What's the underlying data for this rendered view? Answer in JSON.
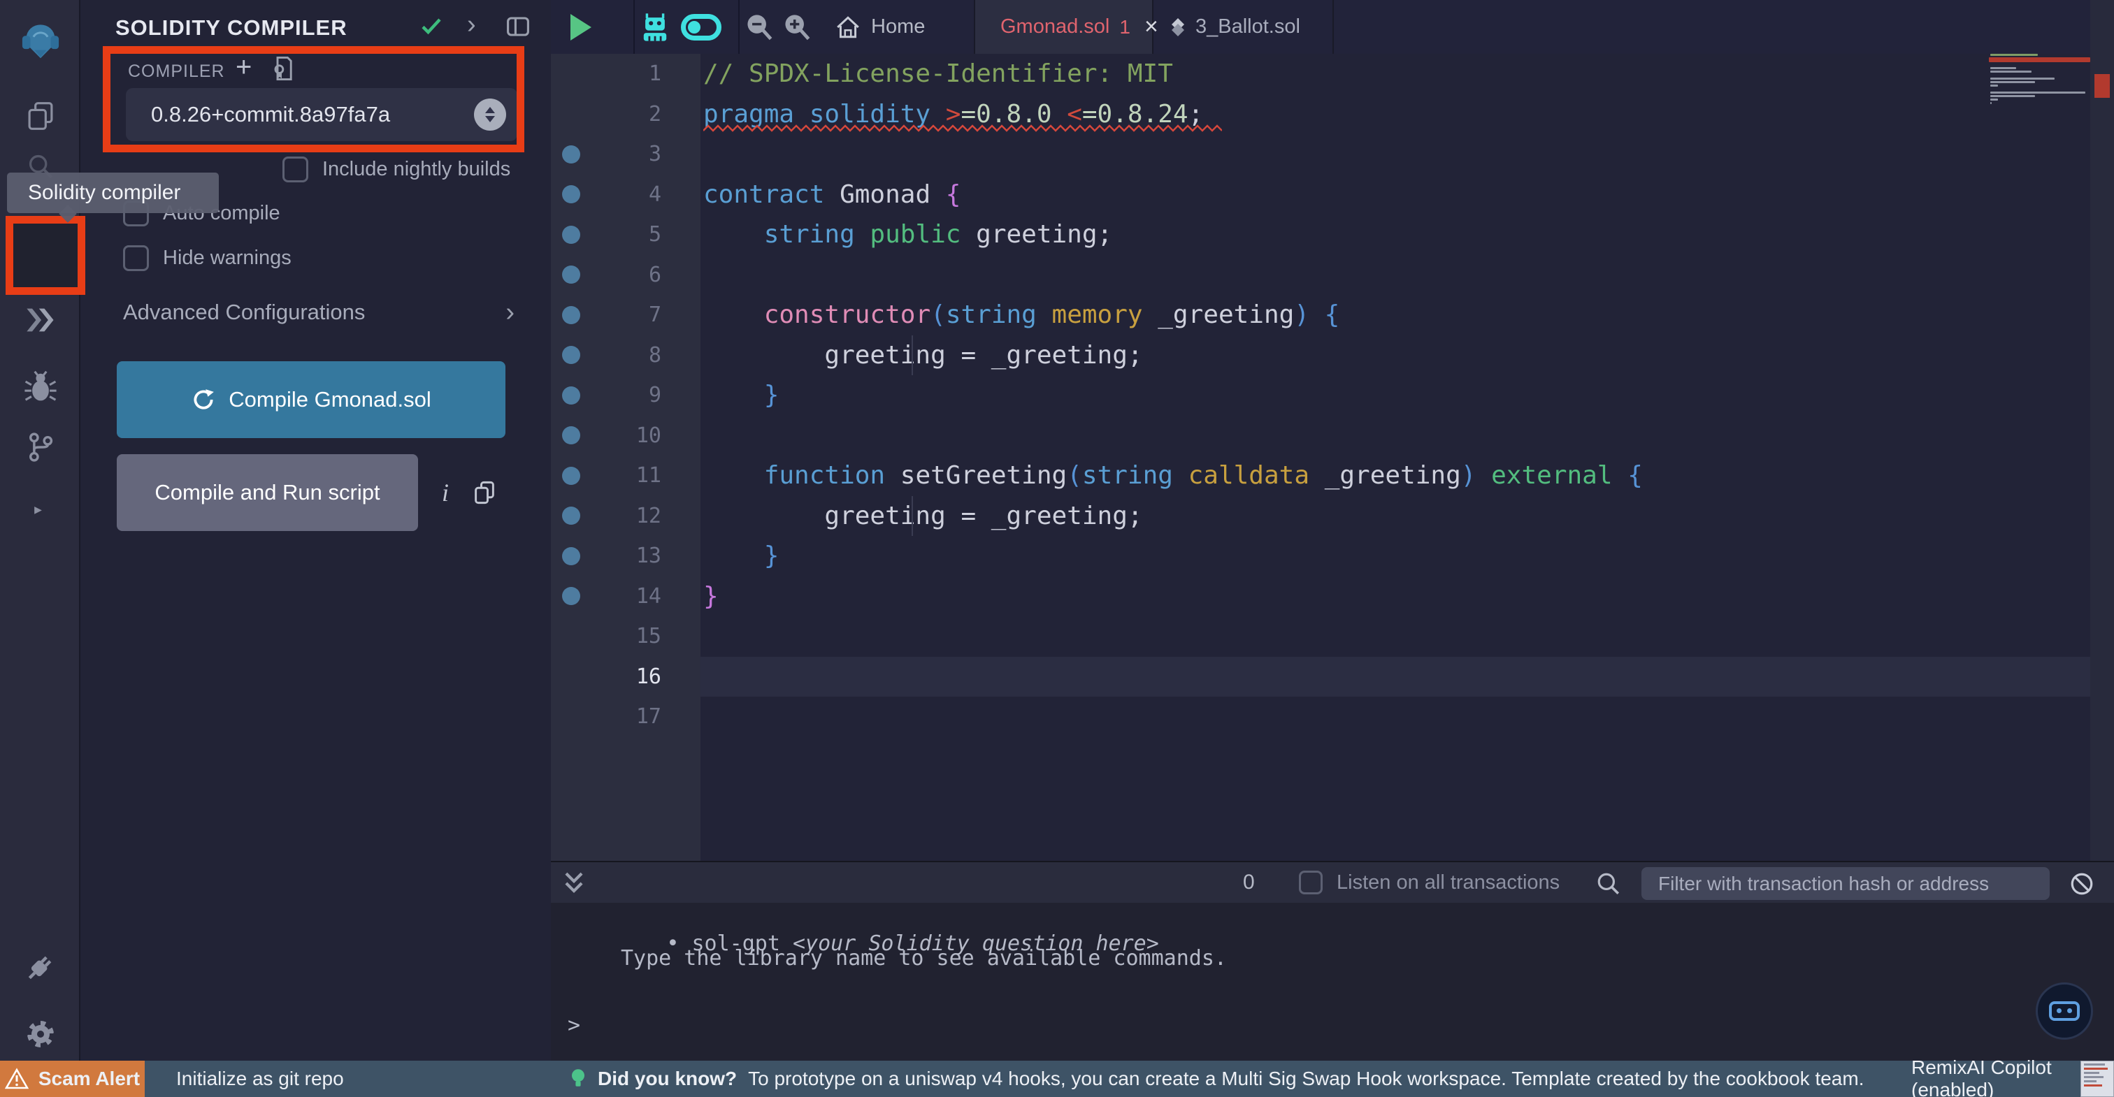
{
  "colors": {
    "accent_cyan": "#3fe0e0",
    "compile_button_blue": "#35789e",
    "run_button_gray": "#65677c",
    "annotation_red": "#e83d16",
    "scam_orange": "#d1793e",
    "statusbar_slate": "#3e5366",
    "tab_active_red": "#e0646e",
    "gutter_dot_blue": "#4e7ca0",
    "play_green": "#57c584",
    "check_green": "#3dbd7d",
    "squiggle_red": "#d6473c",
    "syntax": {
      "comment": "#83a35f",
      "keyword": "#5a9fd4",
      "operator": "#d14a3c",
      "version": "#c1d4bc",
      "plain": "#ced0dc",
      "brace1": "#c678dd",
      "brace2": "#5793d6",
      "modifier": "#53bd7f",
      "storage": "#c8a03f",
      "ctor": "#e08cb6"
    }
  },
  "sidebar": {
    "tooltip": "Solidity compiler",
    "icons": [
      "remix-logo",
      "file-explorer-icon",
      "search-icon",
      "solidity-compiler-icon",
      "deploy-run-icon",
      "debugger-icon",
      "git-icon",
      "plugin-manager-icon",
      "plugin-connector-icon",
      "settings-icon"
    ]
  },
  "panel": {
    "title": "SOLIDITY COMPILER",
    "section_label": "COMPILER",
    "version": "0.8.26+commit.8a97fa7a",
    "checkbox_nightly": "Include nightly builds",
    "checkbox_autocompile": "Auto compile",
    "checkbox_hide_warnings": "Hide warnings",
    "advanced": "Advanced Configurations",
    "compile_button": "Compile Gmonad.sol",
    "run_button": "Compile and Run script"
  },
  "editor": {
    "home_tab": "Home",
    "tabs": [
      {
        "label": "Gmonad.sol",
        "badge": "1",
        "active": true
      },
      {
        "label": "3_Ballot.sol",
        "badge": "",
        "active": false
      }
    ],
    "code_lines": [
      {
        "n": 1,
        "seg": [
          [
            "// SPDX-License-Identifier: MIT",
            "comment"
          ]
        ]
      },
      {
        "n": 2,
        "squiggle": true,
        "seg": [
          [
            "pragma solidity ",
            "keyword"
          ],
          [
            ">",
            "operator"
          ],
          [
            "=0.8.0 ",
            "version"
          ],
          [
            "<",
            "operator"
          ],
          [
            "=0.8.24",
            "version"
          ],
          [
            ";",
            "plain"
          ]
        ]
      },
      {
        "n": 3,
        "dot": true
      },
      {
        "n": 4,
        "dot": true,
        "seg": [
          [
            "contract ",
            "keyword"
          ],
          [
            "Gmonad ",
            "plain"
          ],
          [
            "{",
            "brace1"
          ]
        ]
      },
      {
        "n": 5,
        "dot": true,
        "seg": [
          [
            "    ",
            "plain"
          ],
          [
            "string ",
            "keyword"
          ],
          [
            "public ",
            "modifier"
          ],
          [
            "greeting;",
            "plain"
          ]
        ]
      },
      {
        "n": 6,
        "dot": true
      },
      {
        "n": 7,
        "dot": true,
        "seg": [
          [
            "    ",
            "plain"
          ],
          [
            "constructor",
            "ctor"
          ],
          [
            "(",
            "brace2"
          ],
          [
            "string ",
            "keyword"
          ],
          [
            "memory ",
            "storage"
          ],
          [
            "_greeting",
            "plain"
          ],
          [
            ") {",
            "brace2"
          ]
        ]
      },
      {
        "n": 8,
        "dot": true,
        "guide": true,
        "seg": [
          [
            "        greeting = _greeting;",
            "plain"
          ]
        ]
      },
      {
        "n": 9,
        "dot": true,
        "seg": [
          [
            "    }",
            "brace2"
          ]
        ]
      },
      {
        "n": 10,
        "dot": true
      },
      {
        "n": 11,
        "dot": true,
        "seg": [
          [
            "    ",
            "plain"
          ],
          [
            "function ",
            "keyword"
          ],
          [
            "setGreeting",
            "plain"
          ],
          [
            "(",
            "brace2"
          ],
          [
            "string ",
            "keyword"
          ],
          [
            "calldata ",
            "storage"
          ],
          [
            "_greeting",
            "plain"
          ],
          [
            ") ",
            "brace2"
          ],
          [
            "external ",
            "modifier"
          ],
          [
            "{",
            "brace2"
          ]
        ]
      },
      {
        "n": 12,
        "dot": true,
        "guide": true,
        "seg": [
          [
            "        greeting = _greeting;",
            "plain"
          ]
        ]
      },
      {
        "n": 13,
        "dot": true,
        "seg": [
          [
            "    }",
            "brace2"
          ]
        ]
      },
      {
        "n": 14,
        "dot": true,
        "seg": [
          [
            "}",
            "brace1"
          ]
        ]
      },
      {
        "n": 15
      },
      {
        "n": 16,
        "current": true
      },
      {
        "n": 17
      }
    ]
  },
  "terminal": {
    "badge": "0",
    "listen_label": "Listen on all transactions",
    "filter_placeholder": "Filter with transaction hash or address",
    "line1_bullet": "• ",
    "line1_prefix": "sol-gpt ",
    "line1_italic": "<your Solidity question here>",
    "line2": "Type the library name to see available commands.",
    "prompt": ">"
  },
  "statusbar": {
    "scam_alert": "Scam Alert",
    "git_init": "Initialize as git repo",
    "tip_label": "Did you know?",
    "tip_text": "To prototype on a uniswap v4 hooks, you can create a Multi Sig Swap Hook workspace. Template created by the cookbook team.",
    "copilot": "RemixAI Copilot (enabled)"
  }
}
